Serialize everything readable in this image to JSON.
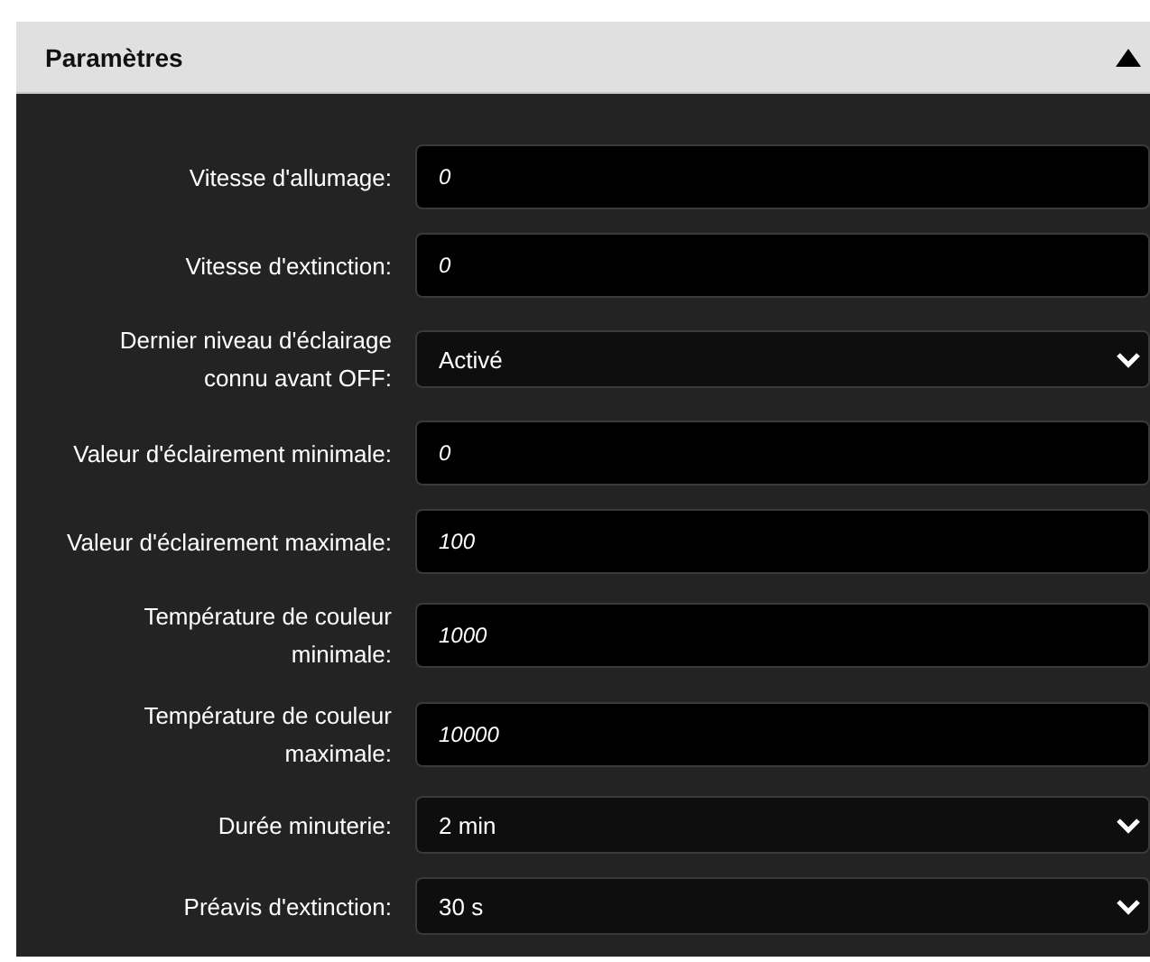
{
  "panel": {
    "title": "Paramètres",
    "expanded": true
  },
  "fields": [
    {
      "kind": "input",
      "label": "Vitesse d'allumage:",
      "value": "0"
    },
    {
      "kind": "input",
      "label": "Vitesse d'extinction:",
      "value": "0"
    },
    {
      "kind": "select",
      "label": "Dernier niveau d'éclairage connu avant OFF:",
      "value": "Activé"
    },
    {
      "kind": "input",
      "label": "Valeur d'éclairement minimale:",
      "value": "0"
    },
    {
      "kind": "input",
      "label": "Valeur d'éclairement maximale:",
      "value": "100"
    },
    {
      "kind": "input",
      "label": "Température de couleur minimale:",
      "value": "1000"
    },
    {
      "kind": "input",
      "label": "Température de couleur maximale:",
      "value": "10000"
    },
    {
      "kind": "select",
      "label": "Durée minuterie:",
      "value": "2 min"
    },
    {
      "kind": "select",
      "label": "Préavis d'extinction:",
      "value": "30 s"
    }
  ]
}
